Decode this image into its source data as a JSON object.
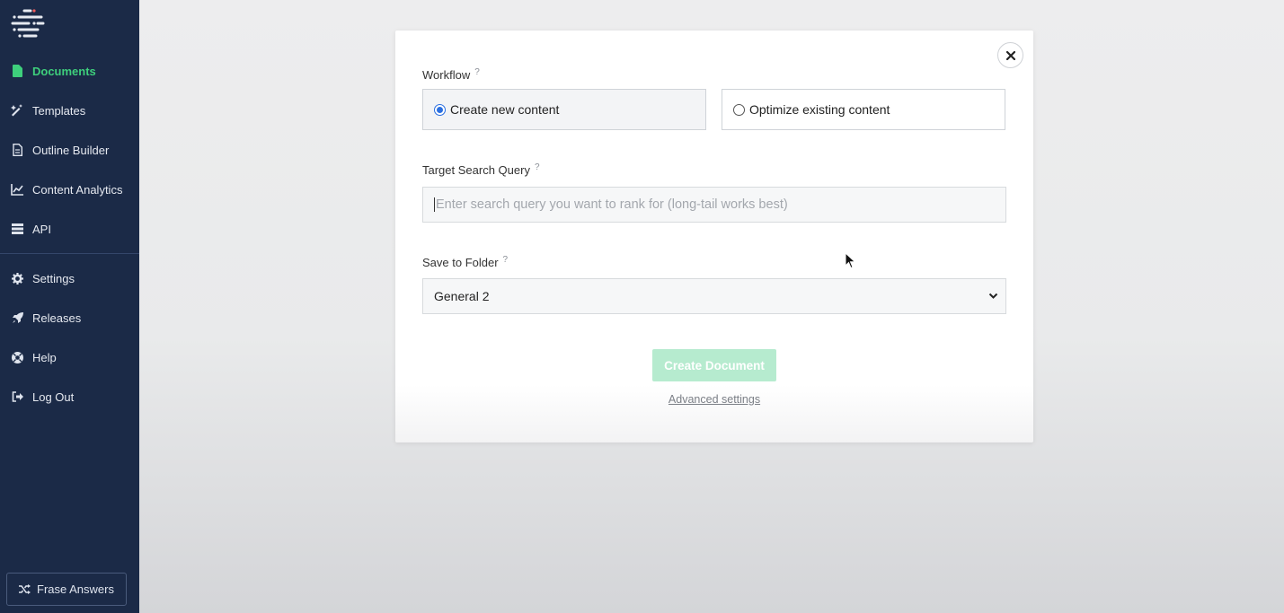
{
  "sidebar": {
    "items": [
      {
        "label": "Documents",
        "icon": "file-icon",
        "active": true
      },
      {
        "label": "Templates",
        "icon": "magic-wand-icon"
      },
      {
        "label": "Outline Builder",
        "icon": "document-outline-icon"
      },
      {
        "label": "Content Analytics",
        "icon": "line-chart-icon"
      },
      {
        "label": "API",
        "icon": "server-icon"
      },
      {
        "label": "Settings",
        "icon": "gear-icon"
      },
      {
        "label": "Releases",
        "icon": "rocket-icon"
      },
      {
        "label": "Help",
        "icon": "lifebuoy-icon"
      },
      {
        "label": "Log Out",
        "icon": "logout-icon"
      }
    ],
    "answers_button": "Frase Answers",
    "accent": "#3ecf7c",
    "bg": "#1b2a47"
  },
  "modal": {
    "workflow_label": "Workflow",
    "workflow_options": [
      "Create new content",
      "Optimize existing content"
    ],
    "workflow_selected": "Create new content",
    "query_label": "Target Search Query",
    "query_placeholder": "Enter search query you want to rank for (long-tail works best)",
    "folder_label": "Save to Folder",
    "folder_value": "General 2",
    "help_mark": "?",
    "create_button": "Create Document",
    "advanced_link": "Advanced settings"
  }
}
